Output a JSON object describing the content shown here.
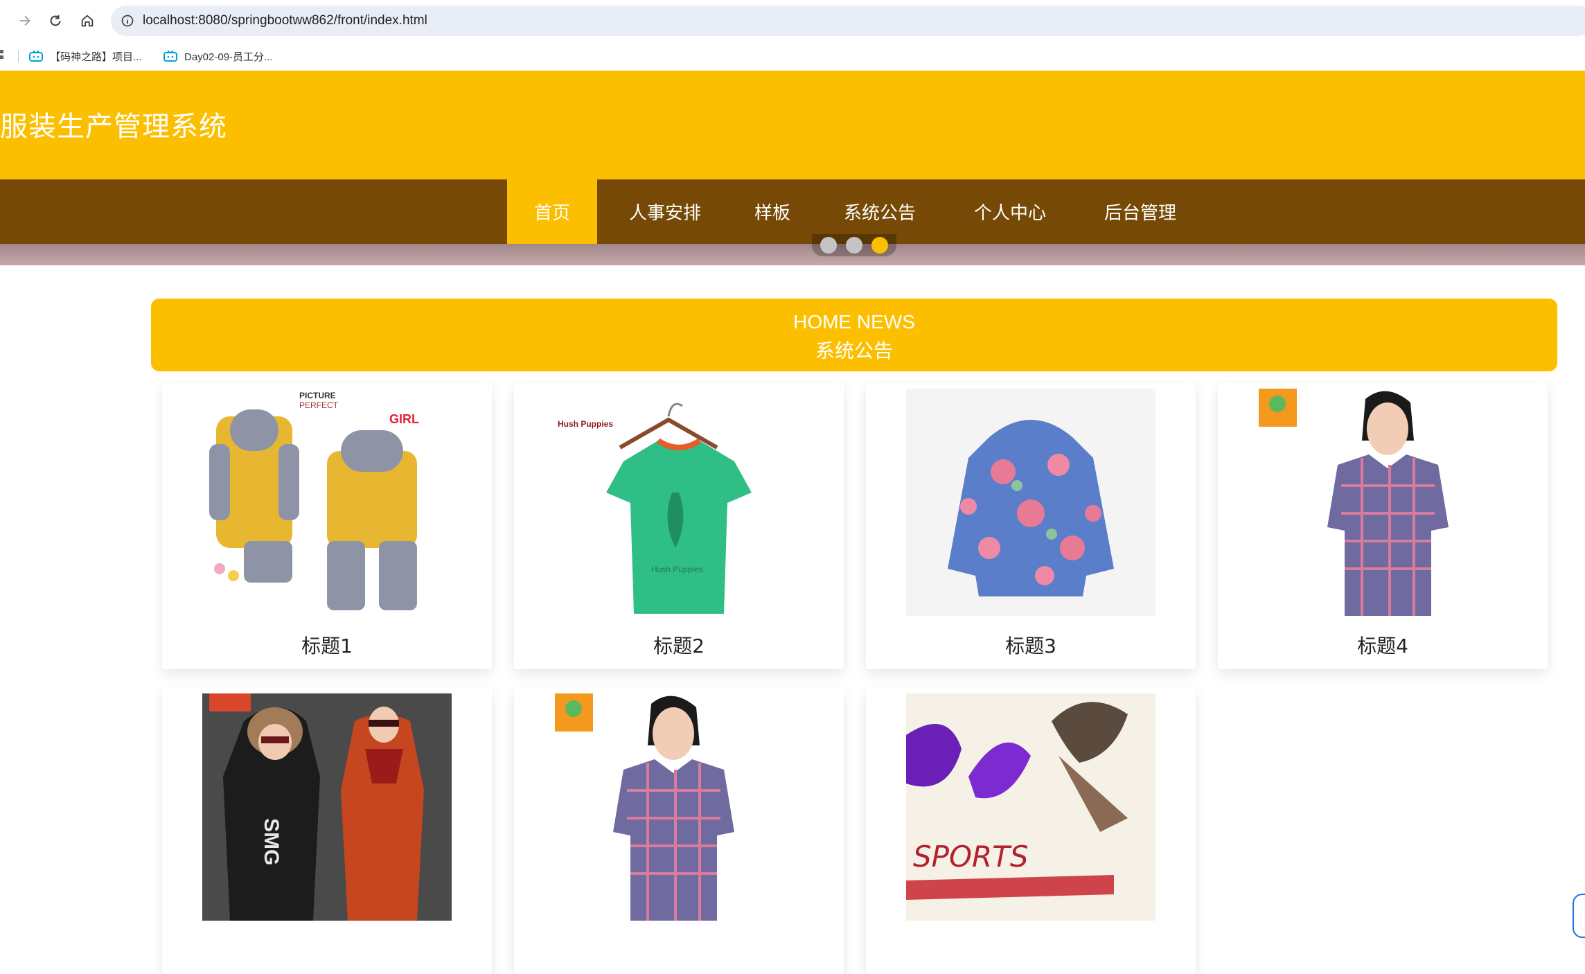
{
  "browser": {
    "url": "localhost:8080/springbootww862/front/index.html",
    "bookmarks": [
      {
        "label": "【码神之路】项目..."
      },
      {
        "label": "Day02-09-员工分..."
      }
    ]
  },
  "site": {
    "title": "服装生产管理系统",
    "brand_color": "#fcbf00",
    "nav_color": "#764a06"
  },
  "nav": {
    "items": [
      {
        "label": "首页",
        "active": true
      },
      {
        "label": "人事安排",
        "active": false
      },
      {
        "label": "样板",
        "active": false
      },
      {
        "label": "系统公告",
        "active": false
      },
      {
        "label": "个人中心",
        "active": false
      },
      {
        "label": "后台管理",
        "active": false
      }
    ]
  },
  "carousel": {
    "slide_count": 3,
    "active_index": 2
  },
  "news": {
    "heading_en": "HOME NEWS",
    "heading_cn": "系统公告",
    "cards": [
      {
        "title": "标题1",
        "image": "kids-yellow-tracksuit"
      },
      {
        "title": "标题2",
        "image": "green-tshirt-on-hanger"
      },
      {
        "title": "标题3",
        "image": "floral-puffer-jacket"
      },
      {
        "title": "标题4",
        "image": "girl-plaid-shirt"
      },
      {
        "title": "",
        "image": "kids-winter-coats"
      },
      {
        "title": "",
        "image": "girl-plaid-shirt"
      },
      {
        "title": "",
        "image": "sports-poster"
      }
    ]
  }
}
